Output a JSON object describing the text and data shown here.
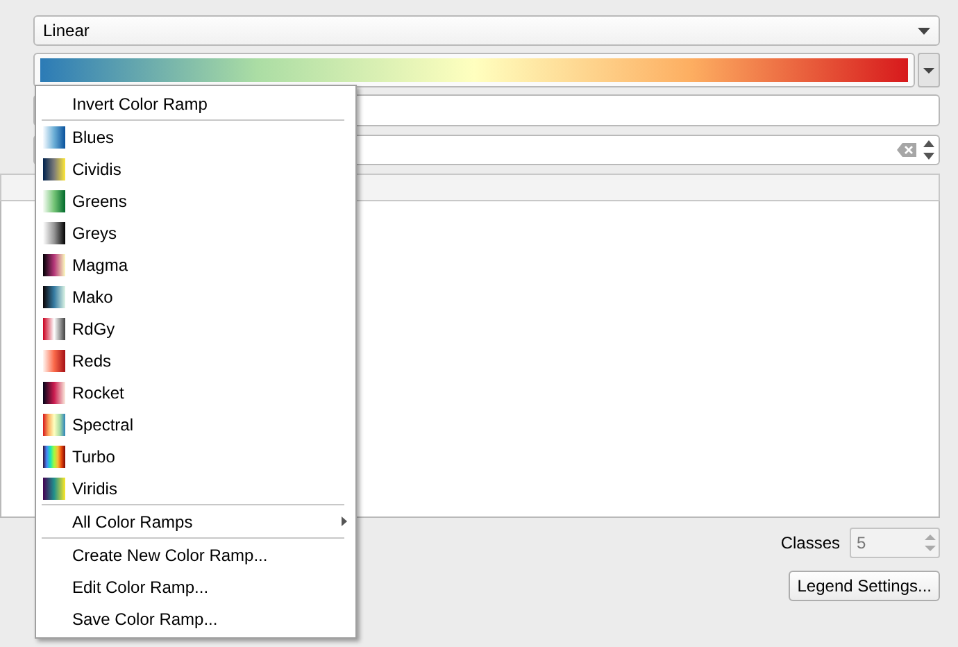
{
  "interpolation_combo": {
    "value": "Linear"
  },
  "classes": {
    "label": "Classes",
    "value": "5",
    "disabled": true
  },
  "legend_button": {
    "label": "Legend Settings..."
  },
  "ramp_menu": {
    "items": [
      {
        "kind": "action",
        "label": "Invert Color Ramp"
      },
      {
        "kind": "separator"
      },
      {
        "kind": "ramp",
        "label": "Blues"
      },
      {
        "kind": "ramp",
        "label": "Cividis"
      },
      {
        "kind": "ramp",
        "label": "Greens"
      },
      {
        "kind": "ramp",
        "label": "Greys"
      },
      {
        "kind": "ramp",
        "label": "Magma"
      },
      {
        "kind": "ramp",
        "label": "Mako"
      },
      {
        "kind": "ramp",
        "label": "RdGy"
      },
      {
        "kind": "ramp",
        "label": "Reds"
      },
      {
        "kind": "ramp",
        "label": "Rocket"
      },
      {
        "kind": "ramp",
        "label": "Spectral"
      },
      {
        "kind": "ramp",
        "label": "Turbo"
      },
      {
        "kind": "ramp",
        "label": "Viridis"
      },
      {
        "kind": "separator"
      },
      {
        "kind": "submenu",
        "label": "All Color Ramps"
      },
      {
        "kind": "separator"
      },
      {
        "kind": "action",
        "label": "Create New Color Ramp..."
      },
      {
        "kind": "action",
        "label": "Edit Color Ramp..."
      },
      {
        "kind": "action",
        "label": "Save Color Ramp..."
      }
    ]
  }
}
